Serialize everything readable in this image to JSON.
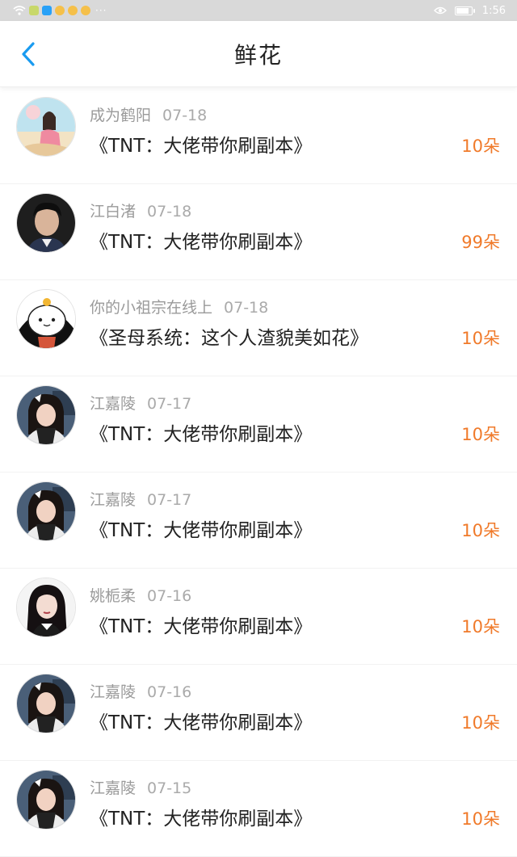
{
  "status_bar": {
    "time": "1:56",
    "icons": [
      "wifi-icon",
      "wechat-icon",
      "qq-icon",
      "weibo-icon",
      "weibo-icon",
      "weibo-icon",
      "more-dots-icon",
      "eye-icon",
      "battery-icon"
    ],
    "dots": "···"
  },
  "header": {
    "title": "鲜花",
    "back_icon": "chevron-left-icon",
    "accent": "#1a9bf0"
  },
  "colors": {
    "amount": "#f07a2a",
    "meta": "#9a9a9a"
  },
  "records": [
    {
      "user": "成为鹤阳",
      "date": "07-18",
      "book": "《TNT：大佬带你刷副本》",
      "amount": "10朵",
      "avatar": "avatar-illustration"
    },
    {
      "user": "江白渚",
      "date": "07-18",
      "book": "《TNT：大佬带你刷副本》",
      "amount": "99朵",
      "avatar": "avatar-man"
    },
    {
      "user": "你的小祖宗在线上",
      "date": "07-18",
      "book": "《圣母系统：这个人渣貌美如花》",
      "amount": "10朵",
      "avatar": "avatar-cartoon"
    },
    {
      "user": "江嘉陵",
      "date": "07-17",
      "book": "《TNT：大佬带你刷副本》",
      "amount": "10朵",
      "avatar": "avatar-girl"
    },
    {
      "user": "江嘉陵",
      "date": "07-17",
      "book": "《TNT：大佬带你刷副本》",
      "amount": "10朵",
      "avatar": "avatar-girl"
    },
    {
      "user": "姚栀柔",
      "date": "07-16",
      "book": "《TNT：大佬带你刷副本》",
      "amount": "10朵",
      "avatar": "avatar-woman"
    },
    {
      "user": "江嘉陵",
      "date": "07-16",
      "book": "《TNT：大佬带你刷副本》",
      "amount": "10朵",
      "avatar": "avatar-girl"
    },
    {
      "user": "江嘉陵",
      "date": "07-15",
      "book": "《TNT：大佬带你刷副本》",
      "amount": "10朵",
      "avatar": "avatar-girl"
    }
  ]
}
